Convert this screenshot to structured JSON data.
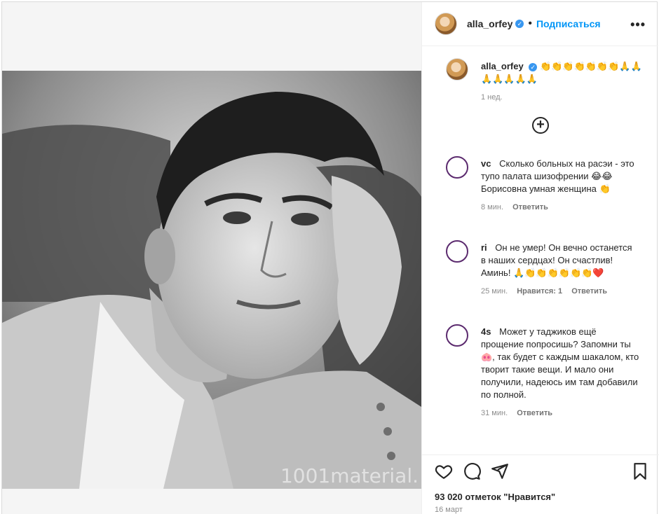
{
  "post": {
    "watermark": "1001material.",
    "account": {
      "username": "alla_orfey",
      "verified_mark": "✓",
      "follow_label": "Подписаться",
      "more_label": "•••"
    },
    "caption": {
      "username": "alla_orfey",
      "text": "👏👏👏👏👏👏👏🙏🙏🙏🙏🙏🙏🙏",
      "time": "1 нед."
    },
    "load_more_label": "+",
    "comments": [
      {
        "user": "vc",
        "text": "Сколько больных на расэи - это тупо палата шизофрении 😂😂 Борисовна умная женщина 👏",
        "time": "8 мин.",
        "likes": "",
        "reply": "Ответить"
      },
      {
        "user": "ri",
        "text": "Он не умер! Он вечно останется в наших сердцах! Он счастлив! Аминь! 🙏👏👏👏👏👏👏❤️",
        "time": "25 мин.",
        "likes": "Нравится: 1",
        "reply": "Ответить"
      },
      {
        "user": "4s",
        "text": "Может у таджиков ещё прощение попросишь? Запомни ты🐽, так будет с каждым шакалом, кто творит такие вещи. И мало они получили, надеюсь им там добавили по полной.",
        "time": "31 мин.",
        "likes": "",
        "reply": "Ответить"
      }
    ],
    "likes_count": "93 020 отметок \"Нравится\"",
    "date": "16 март"
  },
  "icons": [
    "heart-icon",
    "comment-icon",
    "share-icon",
    "bookmark-icon",
    "plus-circle-icon",
    "more-icon",
    "verified-icon"
  ],
  "colors": {
    "accent": "#0095f6",
    "verified": "#3897f0",
    "text": "#262626",
    "muted": "#8e8e8e"
  }
}
